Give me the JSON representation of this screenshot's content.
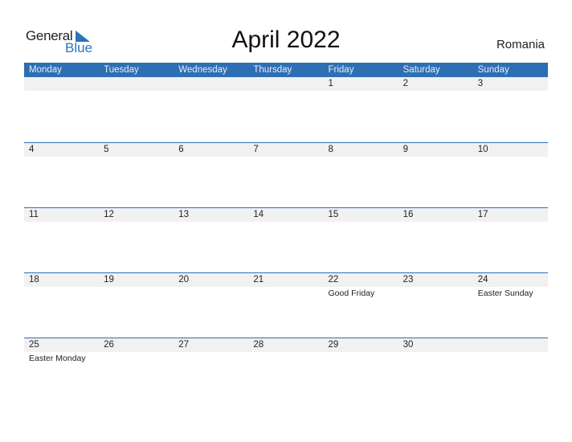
{
  "logo": {
    "text_general": "General",
    "text_blue": "Blue",
    "brand_color": "#2a73bd"
  },
  "title": "April 2022",
  "country": "Romania",
  "header_color": "#2e6fb4",
  "weekdays": [
    "Monday",
    "Tuesday",
    "Wednesday",
    "Thursday",
    "Friday",
    "Saturday",
    "Sunday"
  ],
  "weeks": [
    {
      "days": [
        {
          "num": ""
        },
        {
          "num": ""
        },
        {
          "num": ""
        },
        {
          "num": ""
        },
        {
          "num": "1"
        },
        {
          "num": "2"
        },
        {
          "num": "3"
        }
      ]
    },
    {
      "days": [
        {
          "num": "4"
        },
        {
          "num": "5"
        },
        {
          "num": "6"
        },
        {
          "num": "7"
        },
        {
          "num": "8"
        },
        {
          "num": "9"
        },
        {
          "num": "10"
        }
      ]
    },
    {
      "days": [
        {
          "num": "11"
        },
        {
          "num": "12"
        },
        {
          "num": "13"
        },
        {
          "num": "14"
        },
        {
          "num": "15"
        },
        {
          "num": "16"
        },
        {
          "num": "17"
        }
      ]
    },
    {
      "days": [
        {
          "num": "18"
        },
        {
          "num": "19"
        },
        {
          "num": "20"
        },
        {
          "num": "21"
        },
        {
          "num": "22",
          "holiday": "Good Friday"
        },
        {
          "num": "23"
        },
        {
          "num": "24",
          "holiday": "Easter Sunday"
        }
      ]
    },
    {
      "days": [
        {
          "num": "25",
          "holiday": "Easter Monday"
        },
        {
          "num": "26"
        },
        {
          "num": "27"
        },
        {
          "num": "28"
        },
        {
          "num": "29"
        },
        {
          "num": "30"
        },
        {
          "num": ""
        }
      ]
    }
  ]
}
